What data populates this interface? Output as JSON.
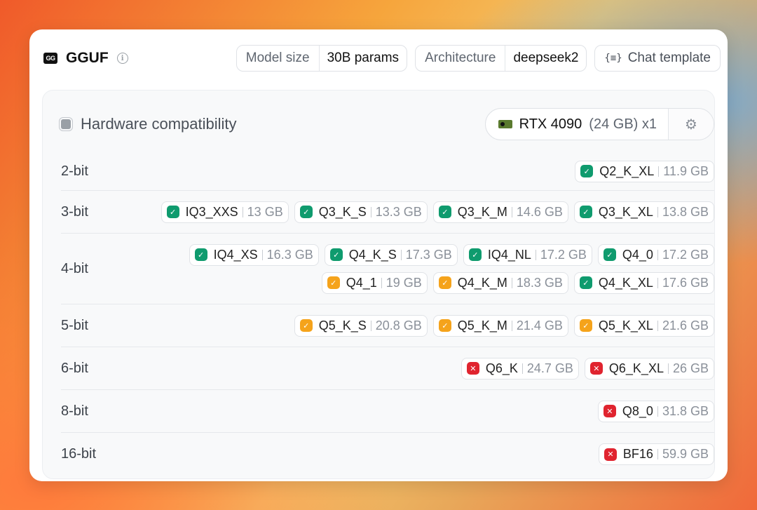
{
  "header": {
    "icon_text": "GG",
    "title": "GGUF",
    "info_glyph": "i",
    "model_size_label": "Model size",
    "model_size_value": "30B params",
    "architecture_label": "Architecture",
    "architecture_value": "deepseek2",
    "chat_template_label": "Chat template",
    "chat_template_icon": "{≡}"
  },
  "hardware": {
    "title": "Hardware compatibility",
    "gpu_name": "RTX 4090",
    "gpu_memory": "(24 GB) x1",
    "gear_glyph": "⚙"
  },
  "colors": {
    "ok": "#0f9b6e",
    "warn": "#f5a31b",
    "bad": "#e0242f"
  },
  "icons": {
    "ok": "check-badge-icon",
    "warn": "check-badge-warning-icon",
    "bad": "x-badge-icon"
  },
  "rows": [
    {
      "label": "2-bit",
      "quants": [
        {
          "name": "Q2_K_XL",
          "size": "11.9 GB",
          "status": "ok"
        }
      ]
    },
    {
      "label": "3-bit",
      "quants": [
        {
          "name": "IQ3_XXS",
          "size": "13 GB",
          "status": "ok"
        },
        {
          "name": "Q3_K_S",
          "size": "13.3 GB",
          "status": "ok"
        },
        {
          "name": "Q3_K_M",
          "size": "14.6 GB",
          "status": "ok"
        },
        {
          "name": "Q3_K_XL",
          "size": "13.8 GB",
          "status": "ok"
        }
      ]
    },
    {
      "label": "4-bit",
      "quants": [
        {
          "name": "IQ4_XS",
          "size": "16.3 GB",
          "status": "ok"
        },
        {
          "name": "Q4_K_S",
          "size": "17.3 GB",
          "status": "ok"
        },
        {
          "name": "IQ4_NL",
          "size": "17.2 GB",
          "status": "ok"
        },
        {
          "name": "Q4_0",
          "size": "17.2 GB",
          "status": "ok"
        },
        {
          "name": "Q4_1",
          "size": "19 GB",
          "status": "warn"
        },
        {
          "name": "Q4_K_M",
          "size": "18.3 GB",
          "status": "warn"
        },
        {
          "name": "Q4_K_XL",
          "size": "17.6 GB",
          "status": "ok"
        }
      ]
    },
    {
      "label": "5-bit",
      "quants": [
        {
          "name": "Q5_K_S",
          "size": "20.8 GB",
          "status": "warn"
        },
        {
          "name": "Q5_K_M",
          "size": "21.4 GB",
          "status": "warn"
        },
        {
          "name": "Q5_K_XL",
          "size": "21.6 GB",
          "status": "warn"
        }
      ]
    },
    {
      "label": "6-bit",
      "quants": [
        {
          "name": "Q6_K",
          "size": "24.7 GB",
          "status": "bad"
        },
        {
          "name": "Q6_K_XL",
          "size": "26 GB",
          "status": "bad"
        }
      ]
    },
    {
      "label": "8-bit",
      "quants": [
        {
          "name": "Q8_0",
          "size": "31.8 GB",
          "status": "bad"
        }
      ]
    },
    {
      "label": "16-bit",
      "quants": [
        {
          "name": "BF16",
          "size": "59.9 GB",
          "status": "bad"
        }
      ]
    }
  ]
}
